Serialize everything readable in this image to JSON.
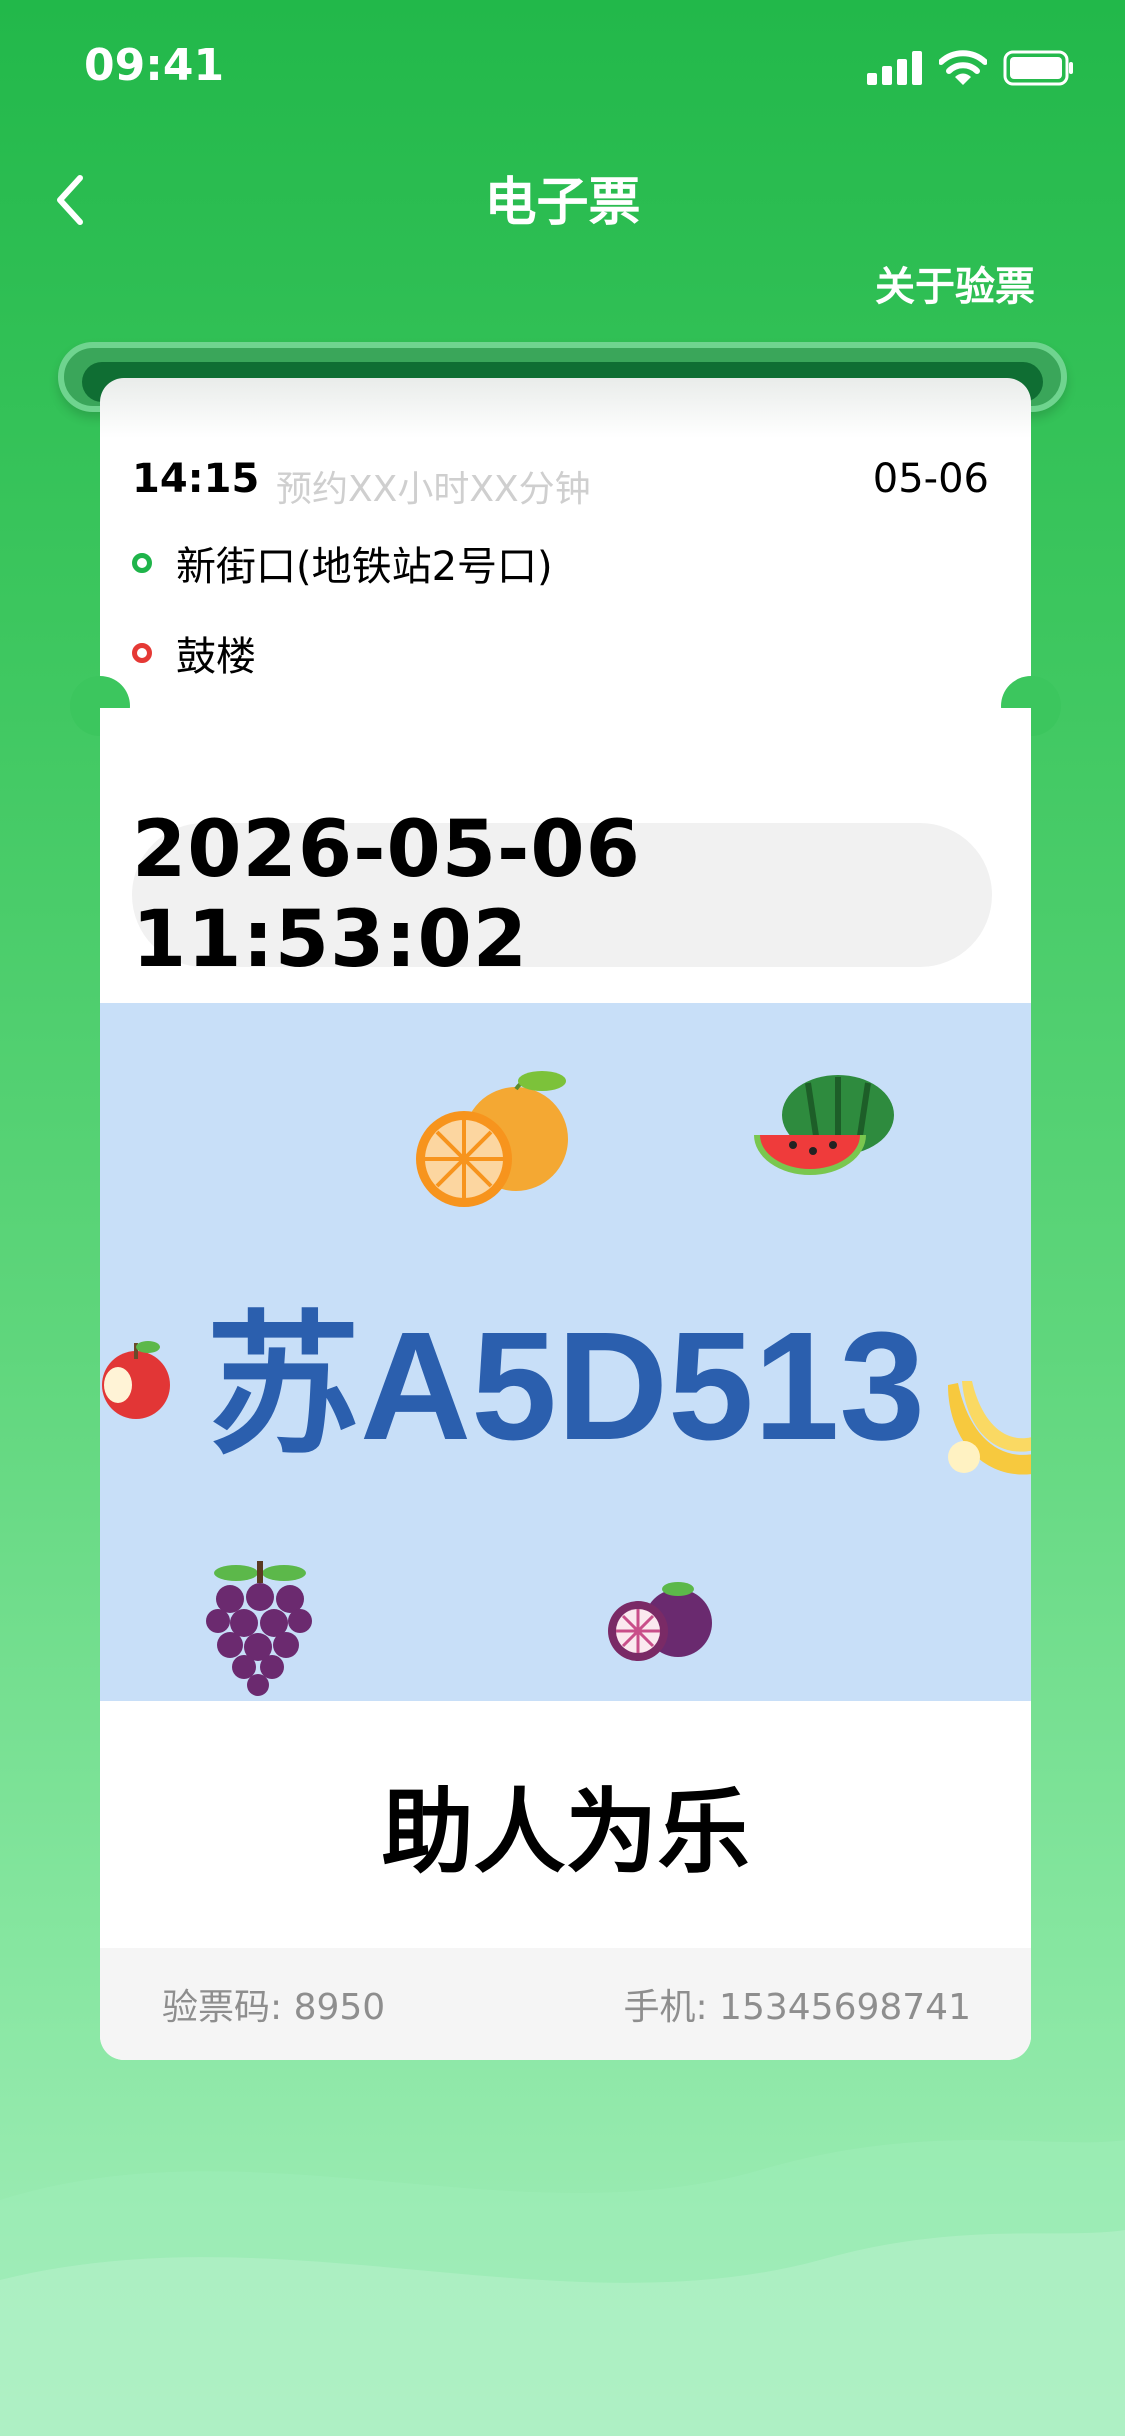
{
  "status_bar": {
    "time": "09:41"
  },
  "nav": {
    "title": "电子票",
    "about_link": "关于验票"
  },
  "trip": {
    "time": "14:15",
    "reserve_hint": "预约XX小时XX分钟",
    "date": "05-06",
    "from": "新街口(地铁站2号口)",
    "to": "鼓楼"
  },
  "ticket": {
    "datetime": "2026-05-06 11:53:02",
    "plate": "苏A5D513",
    "slogan": "助人为乐",
    "code_label": "验票码: 8950",
    "phone_label": "手机: 15345698741"
  },
  "icons": {
    "back": "chevron-left-icon",
    "signal": "cellular-signal-icon",
    "wifi": "wifi-icon",
    "battery": "battery-icon",
    "fruits": [
      "orange-icon",
      "watermelon-icon",
      "apple-icon",
      "banana-icon",
      "grape-icon",
      "mangosteen-icon"
    ]
  },
  "colors": {
    "primary_green": "#22b84a",
    "plate_blue": "#2b5fae",
    "plate_background": "#c8dff8",
    "from_dot": "#1fb44a",
    "to_dot": "#e53935"
  }
}
